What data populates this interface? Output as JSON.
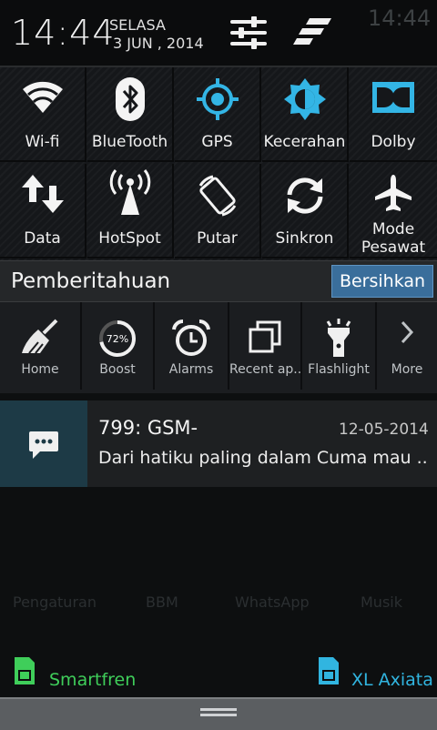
{
  "header": {
    "time": "14:44",
    "day": "SELASA",
    "date": "3 JUN , 2014",
    "ghost_time": "14:44"
  },
  "toggles": [
    {
      "label": "Wi-fi",
      "icon": "wifi-icon"
    },
    {
      "label": "BlueTooth",
      "icon": "bluetooth-icon"
    },
    {
      "label": "GPS",
      "icon": "gps-icon"
    },
    {
      "label": "Kecerahan",
      "icon": "brightness-icon"
    },
    {
      "label": "Dolby",
      "icon": "dolby-icon"
    },
    {
      "label": "Data",
      "icon": "data-arrows-icon"
    },
    {
      "label": "HotSpot",
      "icon": "hotspot-icon"
    },
    {
      "label": "Putar",
      "icon": "rotate-icon"
    },
    {
      "label": "Sinkron",
      "icon": "sync-icon"
    },
    {
      "label": "Mode",
      "label2": "Pesawat",
      "icon": "airplane-icon"
    }
  ],
  "notifications": {
    "title": "Pemberitahuan",
    "clear_label": "Bersihkan"
  },
  "apps": [
    {
      "label": "Home",
      "icon": "broom-icon"
    },
    {
      "label": "Boost",
      "icon": "boost-gauge-icon",
      "value": "72%"
    },
    {
      "label": "Alarms",
      "icon": "alarm-clock-icon"
    },
    {
      "label": "Recent ap...",
      "icon": "recent-apps-icon"
    },
    {
      "label": "Flashlight",
      "icon": "flashlight-icon"
    },
    {
      "label": "More",
      "icon": "chevron-right-icon"
    }
  ],
  "sms": {
    "sender": "799: GSM-",
    "time": "12-05-2014",
    "body": "Dari hatiku paling dalam Cuma mau .."
  },
  "background_labels": [
    "Pengaturan",
    "BBM",
    "WhatsApp",
    "Musik"
  ],
  "sims": [
    {
      "label": "Smartfren",
      "color": "#3fce5a"
    },
    {
      "label": "XL Axiata",
      "color": "#31b5e0"
    }
  ],
  "colors": {
    "accent_blue": "#3a6e9b",
    "gps_blue": "#33b5e5"
  }
}
